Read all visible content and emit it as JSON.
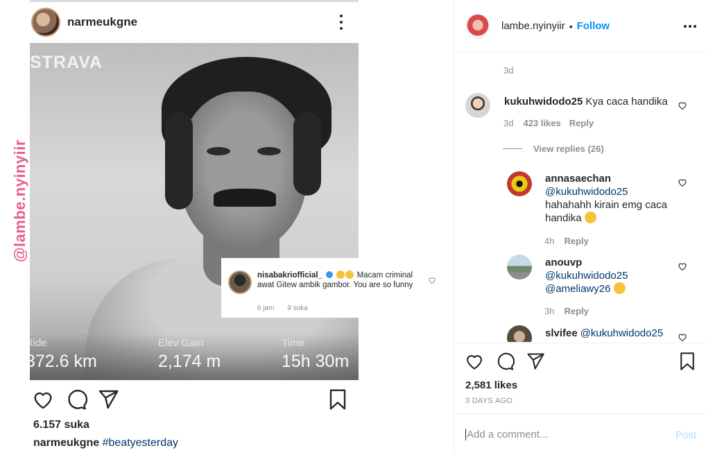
{
  "repost": {
    "username": "narmeukgne",
    "likes": "6.157 suka",
    "caption_user": "narmeukgne",
    "caption_tag": "#beatyesterday",
    "watermark": "@lambe.nyinyiir",
    "strava_brand": "STRAVA",
    "stats": [
      {
        "label": "Ride",
        "value": "372.6 km"
      },
      {
        "label": "Elev Gain",
        "value": "2,174 m"
      },
      {
        "label": "Time",
        "value": "15h 30m"
      }
    ],
    "embedded_comment": {
      "username": "nisabakriofficial_",
      "text": "Macam criminal awat Gitew ambik gambor. You are so funny",
      "time": "6 jam",
      "likes": "9 suka"
    }
  },
  "panel": {
    "username": "lambe.nyinyiir",
    "follow_label": "Follow",
    "dot": "•",
    "first_comment_time": "3d",
    "comments": [
      {
        "username": "kukuhwidodo25",
        "text": "Kya caca handika",
        "time": "3d",
        "likes": "423 likes",
        "reply": "Reply",
        "view_replies": "View replies (26)"
      }
    ],
    "replies": [
      {
        "username": "annasaechan",
        "mention": "@kukuhwidodo25",
        "text": "hahahahh kirain emg caca handika",
        "time": "4h",
        "reply": "Reply"
      },
      {
        "username": "anouvp",
        "mention": "@kukuhwidodo25",
        "mention2": "@ameliawy26",
        "time": "3h",
        "reply": "Reply"
      },
      {
        "username": "slvifee",
        "mention": "@kukuhwidodo25"
      }
    ],
    "likes": "2,581 likes",
    "posted": "3 DAYS AGO",
    "comment_placeholder": "Add a comment...",
    "post_label": "Post"
  },
  "colors": {
    "link_blue": "#0095f6",
    "mention_blue": "#00376b",
    "muted_gray": "#8e8e8e",
    "watermark_pink": "#e85d8b",
    "post_disabled": "#b2dffc"
  },
  "icons": [
    "more-icon",
    "heart-icon",
    "comment-icon",
    "share-icon",
    "bookmark-icon",
    "verified-icon",
    "emoji-icon"
  ]
}
